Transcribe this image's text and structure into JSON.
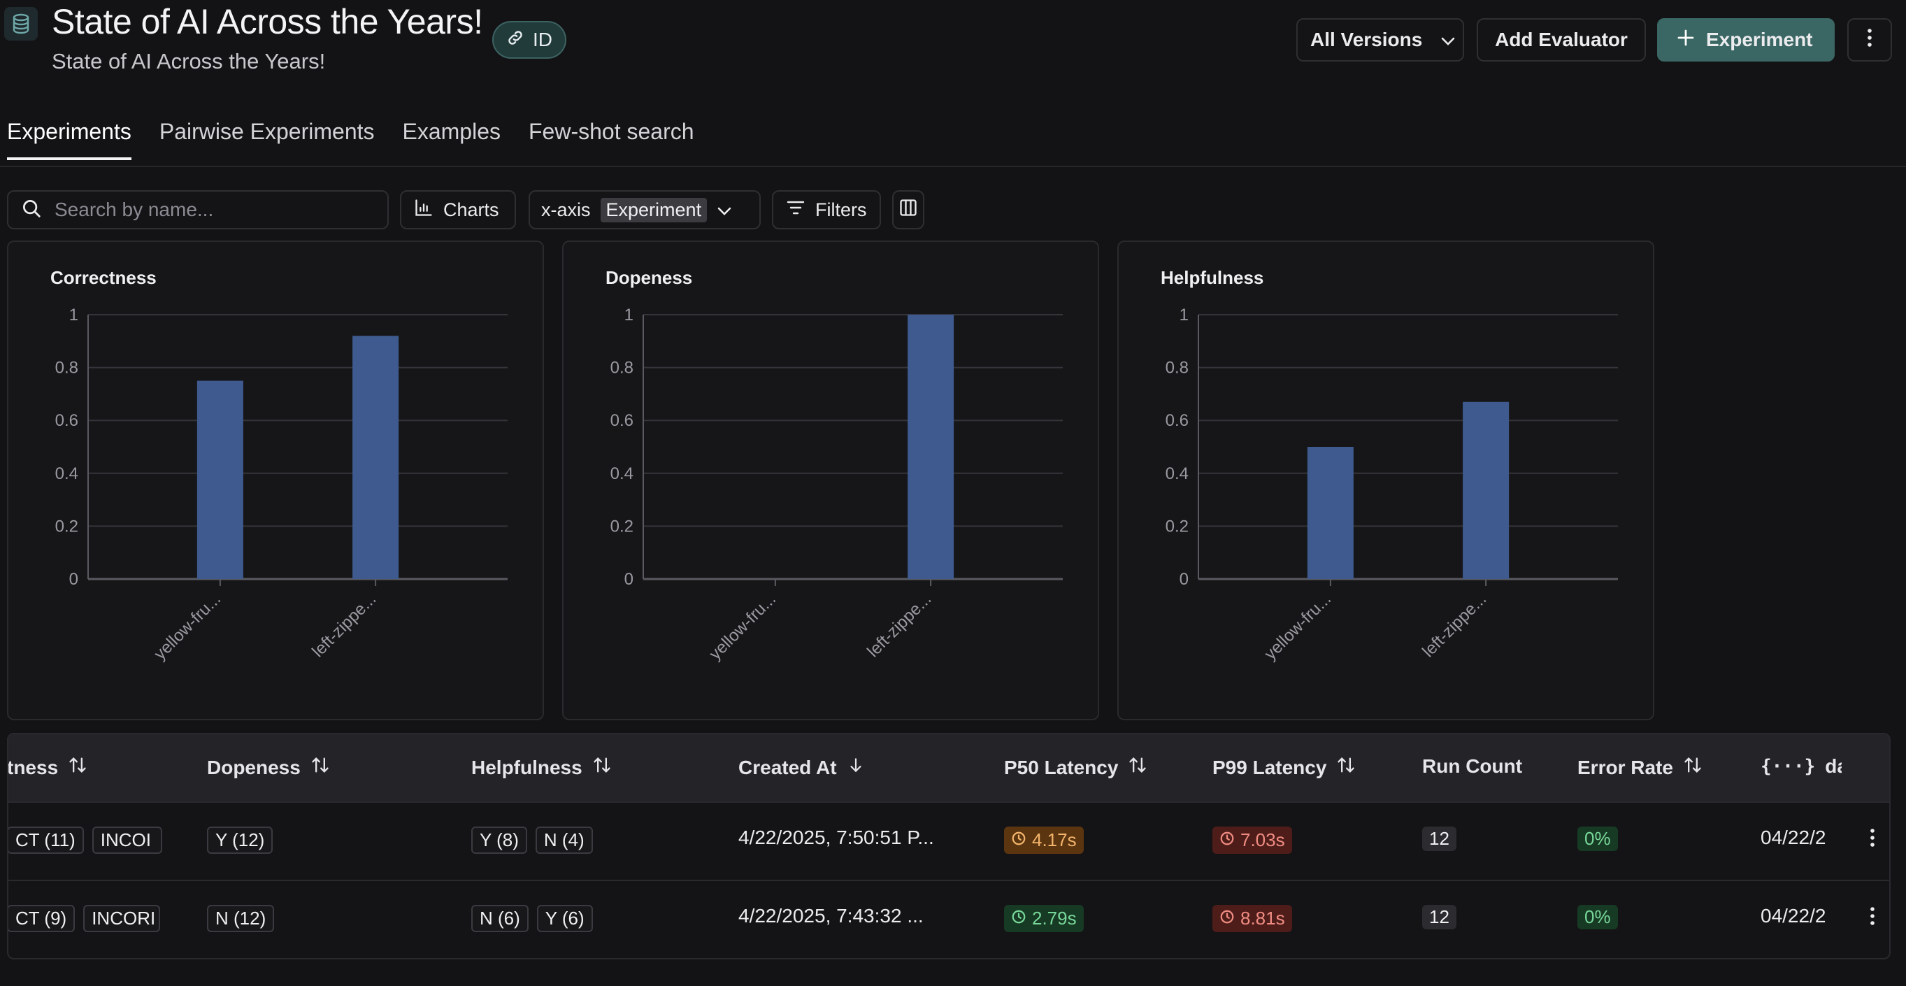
{
  "header": {
    "title": "State of AI Across the Years!",
    "subtitle": "State of AI Across the Years!",
    "id_label": "ID",
    "versions_label": "All Versions",
    "add_evaluator_label": "Add Evaluator",
    "experiment_label": "Experiment"
  },
  "tabs": [
    {
      "label": "Experiments",
      "active": true
    },
    {
      "label": "Pairwise Experiments",
      "active": false
    },
    {
      "label": "Examples",
      "active": false
    },
    {
      "label": "Few-shot search",
      "active": false
    }
  ],
  "toolbar": {
    "search_placeholder": "Search by name...",
    "charts_label": "Charts",
    "xaxis_label": "x-axis",
    "xaxis_value": "Experiment",
    "filters_label": "Filters"
  },
  "colors": {
    "bar": "#3e5a8e",
    "accent": "#3a6764"
  },
  "chart_data": [
    {
      "type": "bar",
      "title": "Correctness",
      "categories": [
        "yellow-fru...",
        "left-zippe..."
      ],
      "values": [
        0.75,
        0.92
      ],
      "ylim": [
        0,
        1
      ],
      "yticks": [
        "0",
        "0.2",
        "0.4",
        "0.6",
        "0.8",
        "1"
      ],
      "grid": true
    },
    {
      "type": "bar",
      "title": "Dopeness",
      "categories": [
        "yellow-fru...",
        "left-zippe..."
      ],
      "values": [
        0,
        1
      ],
      "ylim": [
        0,
        1
      ],
      "yticks": [
        "0",
        "0.2",
        "0.4",
        "0.6",
        "0.8",
        "1"
      ],
      "grid": true
    },
    {
      "type": "bar",
      "title": "Helpfulness",
      "categories": [
        "yellow-fru...",
        "left-zippe..."
      ],
      "values": [
        0.5,
        0.67
      ],
      "ylim": [
        0,
        1
      ],
      "yticks": [
        "0",
        "0.2",
        "0.4",
        "0.6",
        "0.8",
        "1"
      ],
      "grid": true
    }
  ],
  "table": {
    "headers": {
      "correctness": "tness",
      "dopeness": "Dopeness",
      "helpfulness": "Helpfulness",
      "created_at": "Created At",
      "p50": "P50 Latency",
      "p99": "P99 Latency",
      "run_count": "Run Count",
      "error_rate": "Error Rate",
      "data": "data"
    },
    "rows": [
      {
        "correctness": [
          "CT (11)",
          "INCOI"
        ],
        "dopeness": [
          "Y (12)"
        ],
        "helpfulness": [
          "Y (8)",
          "N (4)"
        ],
        "created_at": "4/22/2025, 7:50:51 P...",
        "p50": "4.17s",
        "p50_status": "orange",
        "p99": "7.03s",
        "p99_status": "red",
        "run_count": "12",
        "error_rate": "0%",
        "data": "04/22/2"
      },
      {
        "correctness": [
          "CT (9)",
          "INCORI"
        ],
        "dopeness": [
          "N (12)"
        ],
        "helpfulness": [
          "N (6)",
          "Y (6)"
        ],
        "created_at": "4/22/2025, 7:43:32 ...",
        "p50": "2.79s",
        "p50_status": "green",
        "p99": "8.81s",
        "p99_status": "red",
        "run_count": "12",
        "error_rate": "0%",
        "data": "04/22/2"
      }
    ]
  }
}
